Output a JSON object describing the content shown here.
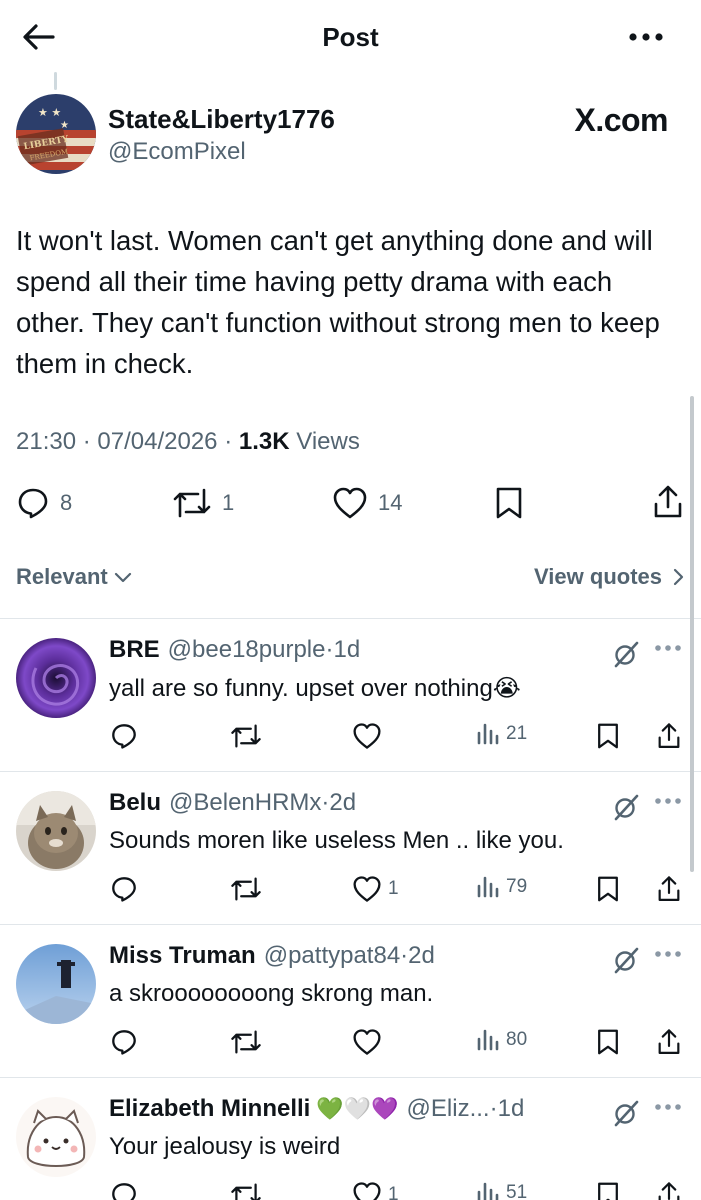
{
  "header": {
    "title": "Post",
    "back_icon": "arrow-left-icon",
    "more_icon": "more-horizontal-icon"
  },
  "post": {
    "author_name": "State&Liberty1776",
    "author_handle": "@EcomPixel",
    "badge": "X.com",
    "avatar_text_1": "LIBERTY",
    "avatar_text_2": "FREEDOM",
    "text": "It won't last. Women can't get anything done and will spend all their time having petty drama with each other. They can't function without strong men to keep them in check.",
    "time": "21:30",
    "date": "07/04/2026",
    "views_count": "1.3K",
    "views_label": "Views",
    "replies": "8",
    "reposts": "1",
    "likes": "14"
  },
  "sort": {
    "relevant": "Relevant",
    "view_quotes": "View quotes"
  },
  "replies": [
    {
      "name": "BRE",
      "emoji": "",
      "handle": "@bee18purple",
      "time": "1d",
      "text": "yall are so funny. upset over nothing😭",
      "likes": "",
      "views": "21"
    },
    {
      "name": "Belu",
      "emoji": "",
      "handle": "@BelenHRMx",
      "time": "2d",
      "text": "Sounds moren like useless Men .. like you.",
      "likes": "1",
      "views": "79"
    },
    {
      "name": "Miss Truman",
      "emoji": "",
      "handle": "@pattypat84",
      "time": "2d",
      "text": "a skroooooooong skrong man.",
      "likes": "",
      "views": "80"
    },
    {
      "name": "Elizabeth Minnelli",
      "emoji": "💚🤍💜",
      "handle": "@Eliz...",
      "time": "1d",
      "text": "Your jealousy is weird",
      "likes": "1",
      "views": "51"
    }
  ],
  "colors": {
    "text": "#0f1419",
    "secondary": "#536471",
    "divider": "#e1e6ea"
  }
}
